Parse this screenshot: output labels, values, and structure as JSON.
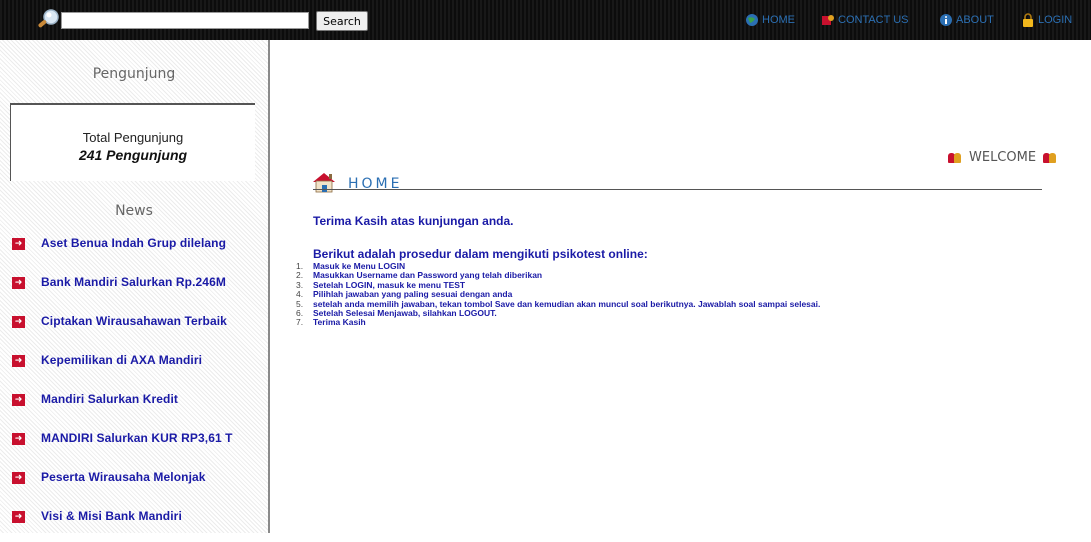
{
  "topbar": {
    "search_placeholder": "",
    "search_button": "Search",
    "nav": [
      {
        "label": "HOME",
        "icon": "globe-icon"
      },
      {
        "label": "CONTACT US",
        "icon": "contact-icon"
      },
      {
        "label": "ABOUT",
        "icon": "info-icon"
      },
      {
        "label": "LOGIN",
        "icon": "lock-icon"
      }
    ]
  },
  "sidebar": {
    "visitors_heading": "Pengunjung",
    "visitors_label": "Total Pengunjung",
    "visitors_value": "241 Pengunjung",
    "news_heading": "News",
    "news": [
      "Aset Benua Indah Grup dilelang",
      "Bank Mandiri Salurkan Rp.246M",
      "Ciptakan Wirausahawan Terbaik",
      "Kepemilikan di AXA Mandiri",
      "Mandiri Salurkan Kredit",
      "MANDIRI Salurkan KUR RP3,61 T",
      "Peserta Wirausaha Melonjak",
      "Visi & Misi Bank Mandiri"
    ]
  },
  "main": {
    "welcome": "WELCOME",
    "title": "HOME",
    "thanks": "Terima Kasih atas kunjungan anda.",
    "procedure_title": "Berikut adalah prosedur dalam mengikuti psikotest online:",
    "steps": [
      "Masuk ke Menu LOGIN",
      "Masukkan Username dan Password yang telah diberikan",
      "Setelah LOGIN, masuk ke menu TEST",
      "Pilihlah jawaban yang paling sesuai dengan anda",
      "setelah anda memilih jawaban, tekan tombol Save dan kemudian akan muncul soal berikutnya. Jawablah soal sampai selesai.",
      "Setelah Selesai Menjawab, silahkan LOGOUT.",
      "Terima Kasih"
    ]
  },
  "colors": {
    "link_blue": "#1a1aa6",
    "accent_blue": "#2b6fb3",
    "news_arrow": "#c8102e"
  }
}
